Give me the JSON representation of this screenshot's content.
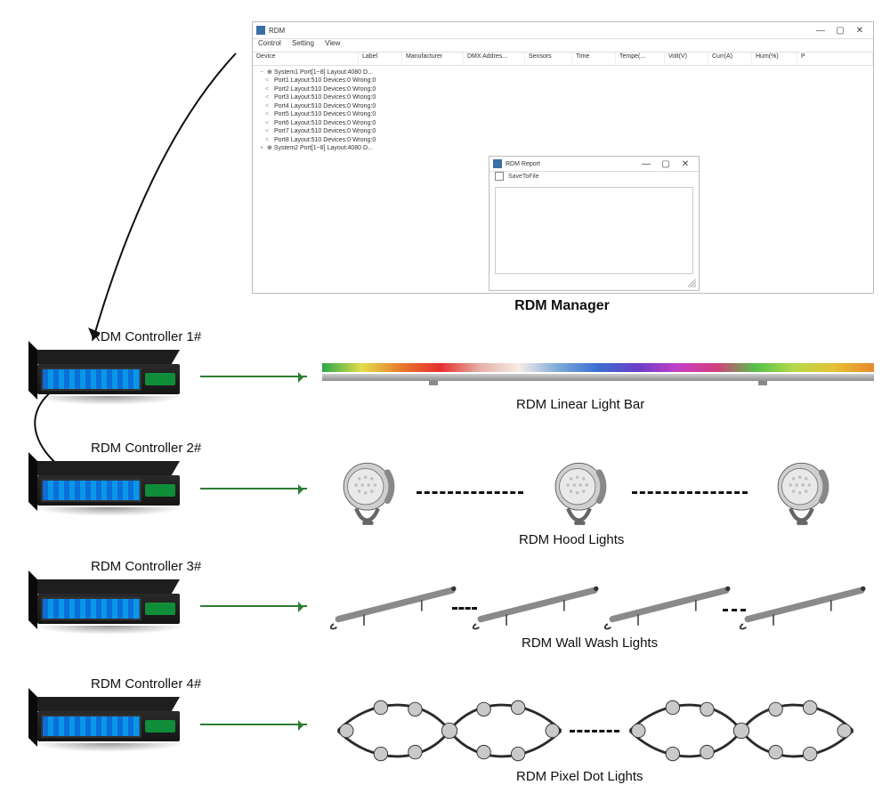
{
  "app": {
    "window_title": "RDM",
    "menu": [
      "Control",
      "Setting",
      "View"
    ],
    "columns": [
      "Device",
      "Label",
      "Manufacturer",
      "DMX Addres...",
      "Sensors",
      "Time",
      "Tempe(...",
      "Volt(V)",
      "Curr(A)",
      "Hum(%)",
      "P"
    ],
    "tree": {
      "system1": "System1 Port[1~8] Layout:4080 D...",
      "ports": [
        "Port1 Layout:510 Devices:0 Wrong:0",
        "Port2 Layout:510 Devices:0 Wrong:0",
        "Port3 Layout:510 Devices:0 Wrong:0",
        "Port4 Layout:510 Devices:0 Wrong:0",
        "Port5 Layout:510 Devices:0 Wrong:0",
        "Port6 Layout:510 Devices:0 Wrong:0",
        "Port7 Layout:510 Devices:0 Wrong:0",
        "Port8 Layout:510 Devices:0 Wrong:0"
      ],
      "system2": "System2 Port[1~8] Layout:4080 D..."
    },
    "inner_window": {
      "title": "RDM Report",
      "save_label": "SaveToFile"
    },
    "caption": "RDM Manager",
    "win_min": "—",
    "win_max": "▢",
    "win_close": "✕"
  },
  "controllers": [
    {
      "label": "RDM Controller 1#"
    },
    {
      "label": "RDM Controller 2#"
    },
    {
      "label": "RDM Controller 3#"
    },
    {
      "label": "RDM Controller 4#"
    }
  ],
  "rows": {
    "linear": "RDM Linear Light Bar",
    "hood": "RDM Hood Lights",
    "wash": "RDM Wall Wash Lights",
    "dots": "RDM Pixel Dot Lights"
  }
}
